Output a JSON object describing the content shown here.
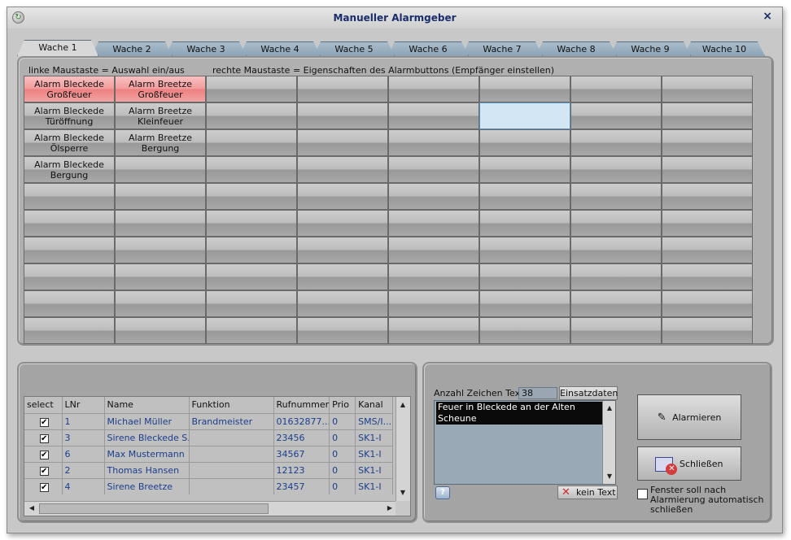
{
  "window": {
    "title": "Manueller Alarmgeber",
    "close_label": "×"
  },
  "tabs": [
    "Wache 1",
    "Wache 2",
    "Wache 3",
    "Wache 4",
    "Wache 5",
    "Wache 6",
    "Wache 7",
    "Wache 8",
    "Wache 9",
    "Wache 10"
  ],
  "active_tab": 0,
  "hints": {
    "left": "linke Maustaste = Auswahl ein/aus",
    "right": "rechte Maustaste = Eigenschaften des Alarmbuttons (Empfänger einstellen)"
  },
  "alarm_grid": {
    "rows": 10,
    "cols": 8,
    "buttons": [
      {
        "row": 0,
        "col": 0,
        "line1": "Alarm Bleckede",
        "line2": "Großfeuer",
        "selected": true
      },
      {
        "row": 0,
        "col": 1,
        "line1": "Alarm Breetze",
        "line2": "Großfeuer",
        "selected": true
      },
      {
        "row": 1,
        "col": 0,
        "line1": "Alarm Bleckede",
        "line2": "Türöffnung",
        "selected": false
      },
      {
        "row": 1,
        "col": 1,
        "line1": "Alarm Breetze",
        "line2": "Kleinfeuer",
        "selected": false
      },
      {
        "row": 2,
        "col": 0,
        "line1": "Alarm Bleckede",
        "line2": "Ölsperre",
        "selected": false
      },
      {
        "row": 2,
        "col": 1,
        "line1": "Alarm Breetze",
        "line2": "Bergung",
        "selected": false
      },
      {
        "row": 3,
        "col": 0,
        "line1": "Alarm Bleckede",
        "line2": "Bergung",
        "selected": false
      }
    ],
    "hover_cell": {
      "row": 1,
      "col": 5
    }
  },
  "recipients": {
    "columns": [
      "select",
      "LNr",
      "Name",
      "Funktion",
      "Rufnummer",
      "Prio",
      "Kanal"
    ],
    "rows": [
      {
        "select": true,
        "lnr": "1",
        "name": "Michael Müller",
        "funktion": "Brandmeister",
        "rufnummer": "01632877...",
        "prio": "0",
        "kanal": "SMS/I..."
      },
      {
        "select": true,
        "lnr": "3",
        "name": "Sirene Bleckede S...",
        "funktion": "",
        "rufnummer": "23456",
        "prio": "0",
        "kanal": "SK1-I"
      },
      {
        "select": true,
        "lnr": "6",
        "name": "Max Mustermann",
        "funktion": "",
        "rufnummer": "34567",
        "prio": "0",
        "kanal": "SK1-I"
      },
      {
        "select": true,
        "lnr": "2",
        "name": "Thomas Hansen",
        "funktion": "",
        "rufnummer": "12123",
        "prio": "0",
        "kanal": "SK1-I"
      },
      {
        "select": true,
        "lnr": "4",
        "name": "Sirene Breetze",
        "funktion": "",
        "rufnummer": "23457",
        "prio": "0",
        "kanal": "SK1-I"
      }
    ]
  },
  "message": {
    "count_label": "Anzahl Zeichen Text",
    "count_value": "38",
    "einsatzdaten_label": "Einsatzdaten",
    "text": "Feuer in Bleckede an der Alten Scheune",
    "kein_text_label": "kein Text",
    "help_label": "?"
  },
  "actions": {
    "alarm_label": "Alarmieren",
    "close_label": "Schließen",
    "autoclose_label": "Fenster soll nach Alarmierung automatisch schließen",
    "autoclose_checked": false
  }
}
